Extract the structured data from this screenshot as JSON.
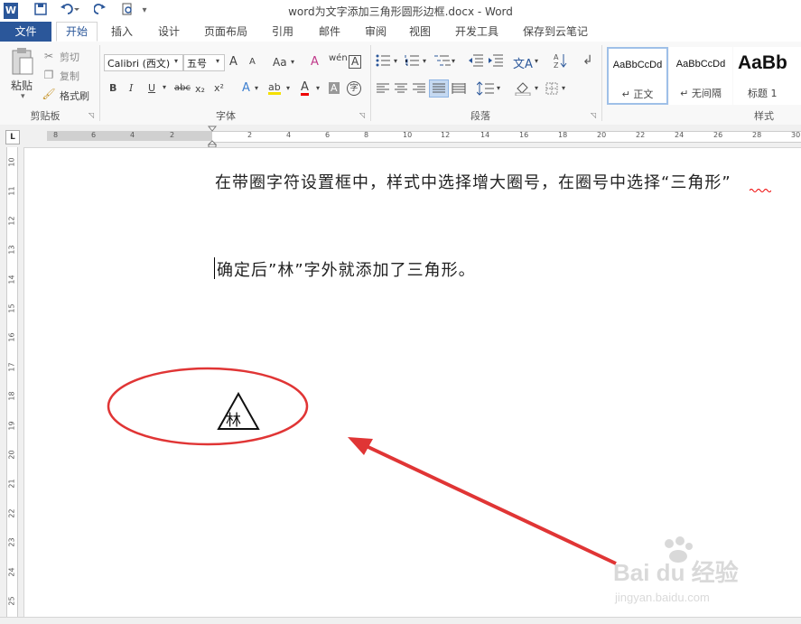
{
  "window": {
    "title": "word为文字添加三角形圆形边框.docx - Word"
  },
  "quick_access": {
    "word_icon": "W",
    "save_icon": "save-icon",
    "undo_icon": "undo-icon",
    "redo_icon": "redo-icon",
    "preview_icon": "print-preview-icon"
  },
  "tabs": [
    "文件",
    "开始",
    "插入",
    "设计",
    "页面布局",
    "引用",
    "邮件",
    "审阅",
    "视图",
    "开发工具",
    "保存到云笔记"
  ],
  "clipboard": {
    "paste": "粘贴",
    "cut": "剪切",
    "copy": "复制",
    "format_painter": "格式刷",
    "label": "剪贴板"
  },
  "font": {
    "name": "Calibri (西文)",
    "size": "五号",
    "grow": "A",
    "shrink": "A",
    "case": "Aa",
    "clear": "A",
    "phonetic": "wén",
    "border_char": "A",
    "bold": "B",
    "italic": "I",
    "underline": "U",
    "strike": "abc",
    "sub": "x₂",
    "sup": "x²",
    "effects": "A",
    "highlight": "ab",
    "color": "A",
    "shade": "A",
    "enclose": "字",
    "label": "字体"
  },
  "paragraph": {
    "label": "段落"
  },
  "styles": {
    "items": [
      {
        "sample": "AaBbCcDd",
        "name": "↵ 正文"
      },
      {
        "sample": "AaBbCcDd",
        "name": "↵ 无间隔"
      },
      {
        "sample": "AaBb",
        "name": "标题 1"
      }
    ],
    "label": "样式"
  },
  "ruler": {
    "h_ticks": [
      "8",
      "6",
      "4",
      "2",
      "2",
      "4",
      "6",
      "8",
      "10",
      "12",
      "14",
      "16",
      "18",
      "20",
      "22",
      "24",
      "26",
      "28",
      "30"
    ],
    "v_ticks": [
      "10",
      "11",
      "12",
      "13",
      "14",
      "15",
      "16",
      "17",
      "18",
      "19",
      "20",
      "21",
      "22",
      "23",
      "24",
      "25"
    ],
    "corner": "L"
  },
  "document": {
    "para1": "在带圈字符设置框中，样式中选择增大圈号，在圈号中选择“三角形”",
    "para2": "确定后”林”字外就添加了三角形。",
    "enclosed_char": "林"
  },
  "watermark": {
    "brand": "Bai du 经验",
    "url": "jingyan.baidu.com"
  },
  "colors": {
    "accent": "#2b579a",
    "annotation": "#e03535"
  }
}
